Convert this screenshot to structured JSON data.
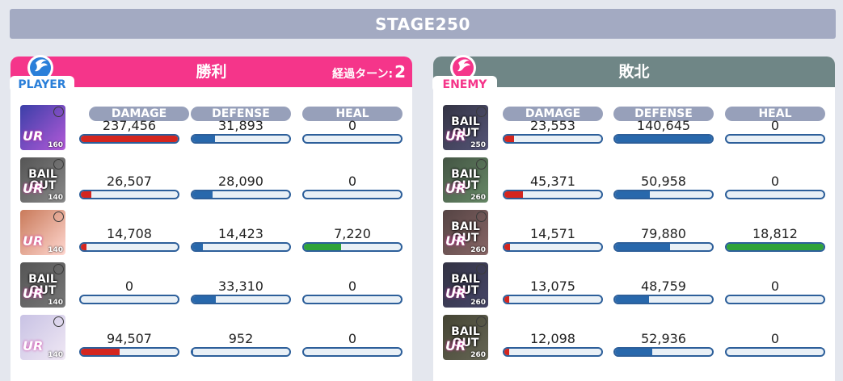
{
  "stage_title": "STAGE250",
  "player": {
    "team_logo_text": "PLAYER",
    "result": "勝利",
    "turn_label": "経過ターン:",
    "turn_count": "2",
    "headers": {
      "damage": "DAMAGE",
      "defense": "DEFENSE",
      "heal": "HEAL"
    },
    "accent_color": "#f5358a",
    "units": [
      {
        "level": "160",
        "bail_out": false,
        "rarity": "UR",
        "damage": "237,456",
        "defense": "31,893",
        "heal": "0",
        "damage_fill": 1.0,
        "defense_fill": 0.23,
        "heal_fill": 0.0,
        "portrait_colors": [
          "#3b3fa8",
          "#b35ad8"
        ]
      },
      {
        "level": "140",
        "bail_out": true,
        "bail_line1": "BAIL",
        "bail_line2": "OUT",
        "rarity": "UR",
        "damage": "26,507",
        "defense": "28,090",
        "heal": "0",
        "damage_fill": 0.11,
        "defense_fill": 0.21,
        "heal_fill": 0.0,
        "portrait_colors": [
          "#555",
          "#888"
        ]
      },
      {
        "level": "140",
        "bail_out": false,
        "rarity": "UR",
        "damage": "14,708",
        "defense": "14,423",
        "heal": "7,220",
        "damage_fill": 0.06,
        "defense_fill": 0.11,
        "heal_fill": 0.38,
        "portrait_colors": [
          "#c97a5a",
          "#ffd7d0"
        ]
      },
      {
        "level": "140",
        "bail_out": true,
        "bail_line1": "BAIL",
        "bail_line2": "OUT",
        "rarity": "UR",
        "damage": "0",
        "defense": "33,310",
        "heal": "0",
        "damage_fill": 0.0,
        "defense_fill": 0.24,
        "heal_fill": 0.0,
        "portrait_colors": [
          "#555",
          "#777"
        ]
      },
      {
        "level": "140",
        "bail_out": false,
        "rarity": "UR",
        "damage": "94,507",
        "defense": "952",
        "heal": "0",
        "damage_fill": 0.4,
        "defense_fill": 0.01,
        "heal_fill": 0.0,
        "portrait_colors": [
          "#c8c2e4",
          "#f0e8f4"
        ]
      }
    ]
  },
  "enemy": {
    "team_logo_text": "ENEMY",
    "result": "敗北",
    "headers": {
      "damage": "DAMAGE",
      "defense": "DEFENSE",
      "heal": "HEAL"
    },
    "accent_color": "#6f8686",
    "units": [
      {
        "level": "250",
        "bail_out": true,
        "bail_line1": "BAIL",
        "bail_line2": "OUT",
        "rarity": "UR",
        "damage": "23,553",
        "defense": "140,645",
        "heal": "0",
        "damage_fill": 0.1,
        "defense_fill": 1.0,
        "heal_fill": 0.0,
        "portrait_colors": [
          "#334",
          "#557"
        ]
      },
      {
        "level": "260",
        "bail_out": true,
        "bail_line1": "BAIL",
        "bail_line2": "OUT",
        "rarity": "UR",
        "damage": "45,371",
        "defense": "50,958",
        "heal": "0",
        "damage_fill": 0.19,
        "defense_fill": 0.36,
        "heal_fill": 0.0,
        "portrait_colors": [
          "#454",
          "#686"
        ]
      },
      {
        "level": "260",
        "bail_out": true,
        "bail_line1": "BAIL",
        "bail_line2": "OUT",
        "rarity": "UR",
        "damage": "14,571",
        "defense": "79,880",
        "heal": "18,812",
        "damage_fill": 0.06,
        "defense_fill": 0.57,
        "heal_fill": 1.0,
        "portrait_colors": [
          "#544",
          "#866"
        ]
      },
      {
        "level": "260",
        "bail_out": true,
        "bail_line1": "BAIL",
        "bail_line2": "OUT",
        "rarity": "UR",
        "damage": "13,075",
        "defense": "48,759",
        "heal": "0",
        "damage_fill": 0.05,
        "defense_fill": 0.35,
        "heal_fill": 0.0,
        "portrait_colors": [
          "#334",
          "#446"
        ]
      },
      {
        "level": "260",
        "bail_out": true,
        "bail_line1": "BAIL",
        "bail_line2": "OUT",
        "rarity": "UR",
        "damage": "12,098",
        "defense": "52,936",
        "heal": "0",
        "damage_fill": 0.05,
        "defense_fill": 0.38,
        "heal_fill": 0.0,
        "portrait_colors": [
          "#443",
          "#665"
        ]
      }
    ]
  }
}
